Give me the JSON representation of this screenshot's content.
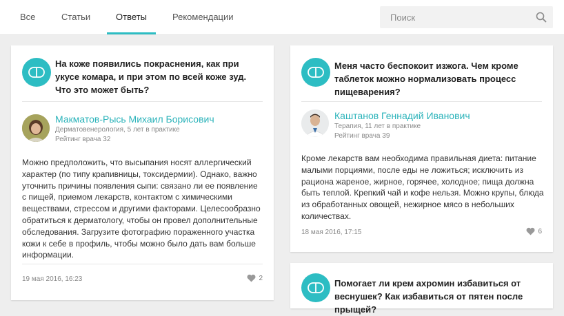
{
  "tabs": [
    {
      "label": "Все"
    },
    {
      "label": "Статьи"
    },
    {
      "label": "Ответы"
    },
    {
      "label": "Рекомендации"
    }
  ],
  "search": {
    "placeholder": "Поиск"
  },
  "colors": {
    "accent": "#2dbdc3",
    "doctor_name": "#2bb3ba"
  },
  "cards": [
    {
      "question": "На коже появились покраснения, как при укусе комара, и при этом по всей коже зуд. Что это может быть?",
      "doctor_name": "Макматов-Рысь Михаил Борисович",
      "specialty": "Дерматовенерология, 5 лет в практике",
      "rating": "Рейтинг врача 32",
      "answer": "Можно предположить, что высыпания носят аллергический характер (по типу крапивницы, токсидермии). Однако, важно уточнить причины появления сыпи: связано ли ее появление с пищей, приемом лекарств, контактом с химическими веществами, стрессом и другими факторами. Целесообразно обратиться к дерматологу, чтобы он провел дополнительные обследования. Загрузите фотографию пораженного участка кожи к себе в профиль, чтобы можно было дать вам больше информации.",
      "date": "19 мая 2016, 16:23",
      "likes": "2"
    },
    {
      "question": "Меня часто беспокоит изжога. Чем кроме таблеток можно нормализовать процесс пищеварения?",
      "doctor_name": "Каштанов Геннадий Иванович",
      "specialty": "Терапия, 11 лет в практике",
      "rating": "Рейтинг врача 39",
      "answer": "Кроме лекарств вам необходима правильная диета: питание малыми порциями, после еды не ложиться; исключить из рациона жареное, жирное, горячее, холодное; пища должна быть теплой. Крепкий чай и кофе нельзя. Можно крупы, блюда из обработанных овощей, нежирное мясо в небольших количествах.",
      "date": "18 мая 2016, 17:15",
      "likes": "6"
    },
    {
      "question": "Помогает ли крем ахромин избавиться от веснушек? Как избавиться от пятен после прыщей?"
    }
  ]
}
